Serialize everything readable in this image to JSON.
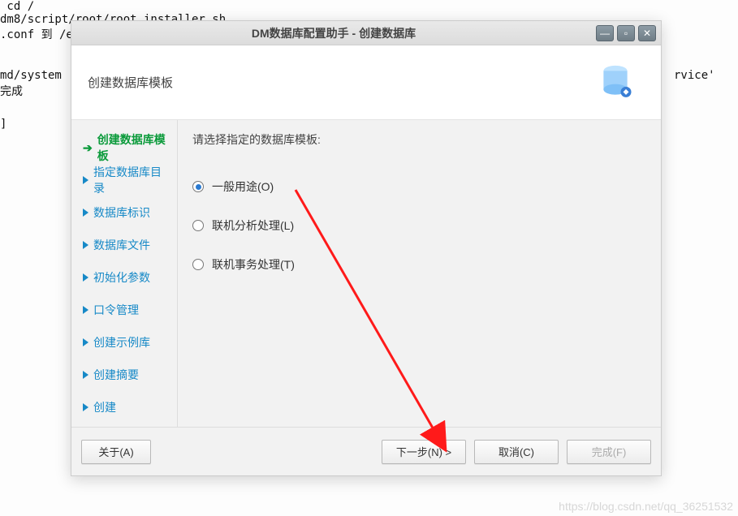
{
  "terminal": {
    "l1": " cd /",
    "l2": "dm8/script/root/root_installer.sh",
    "l3": ".conf 到 /e",
    "l4": "md/system",
    "l5": "完成",
    "l6": "rvice'",
    "l7": "]"
  },
  "dialog": {
    "title": "DM数据库配置助手 - 创建数据库",
    "header": "创建数据库模板",
    "sidebar": {
      "items": [
        {
          "label": "创建数据库模板",
          "active": true
        },
        {
          "label": "指定数据库目录"
        },
        {
          "label": "数据库标识"
        },
        {
          "label": "数据库文件"
        },
        {
          "label": "初始化参数"
        },
        {
          "label": "口令管理"
        },
        {
          "label": "创建示例库"
        },
        {
          "label": "创建摘要"
        },
        {
          "label": "创建"
        }
      ]
    },
    "content": {
      "prompt": "请选择指定的数据库模板:",
      "options": [
        {
          "label": "一般用途(O)",
          "selected": true
        },
        {
          "label": "联机分析处理(L)"
        },
        {
          "label": "联机事务处理(T)"
        }
      ]
    },
    "footer": {
      "about": "关于(A)",
      "next": "下一步(N) >",
      "cancel": "取消(C)",
      "finish": "完成(F)"
    }
  },
  "watermark": "https://blog.csdn.net/qq_36251532"
}
